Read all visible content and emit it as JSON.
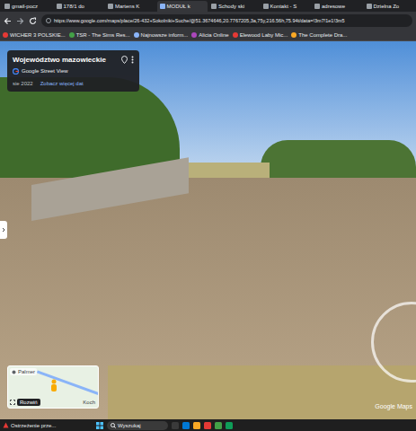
{
  "browser": {
    "tabs": [
      {
        "label": "gmail-pocz",
        "selected": false
      },
      {
        "label": "178/1 do",
        "selected": false
      },
      {
        "label": "Martens K",
        "selected": false
      },
      {
        "label": "MODUŁ k",
        "selected": true
      },
      {
        "label": "Schody ski",
        "selected": false
      },
      {
        "label": "Kontakt - S",
        "selected": false
      },
      {
        "label": "adresowe",
        "selected": false
      },
      {
        "label": "Dzielna Zo",
        "selected": false
      }
    ],
    "address": "https://www.google.com/maps/place/26-432+Sokolniki+Suche/@51.3674646,20.7767205,3a,75y,216.56h,75.94t/data=!3m7!1e1!3m5",
    "bookmarks": [
      "WICHER 3 POLSKIE...",
      "TSR - The Sims Res...",
      "Najnowsze inform...",
      "Alicia Online",
      "Elewood Laby Mic...",
      "The Complete Dra..."
    ]
  },
  "street_view": {
    "place": "Województwo mazowieckie",
    "source": "Google Street View",
    "date": "sie 2022",
    "more_dates": "Zobacz więcej dat",
    "minimap": {
      "label_top": "Palmer",
      "label_bottom": "Koch",
      "expand": "Rozwiń"
    },
    "watermark": "Google Maps"
  },
  "taskbar": {
    "notification": "Ostrzeżenie prze...",
    "search": "Wyszukaj"
  }
}
